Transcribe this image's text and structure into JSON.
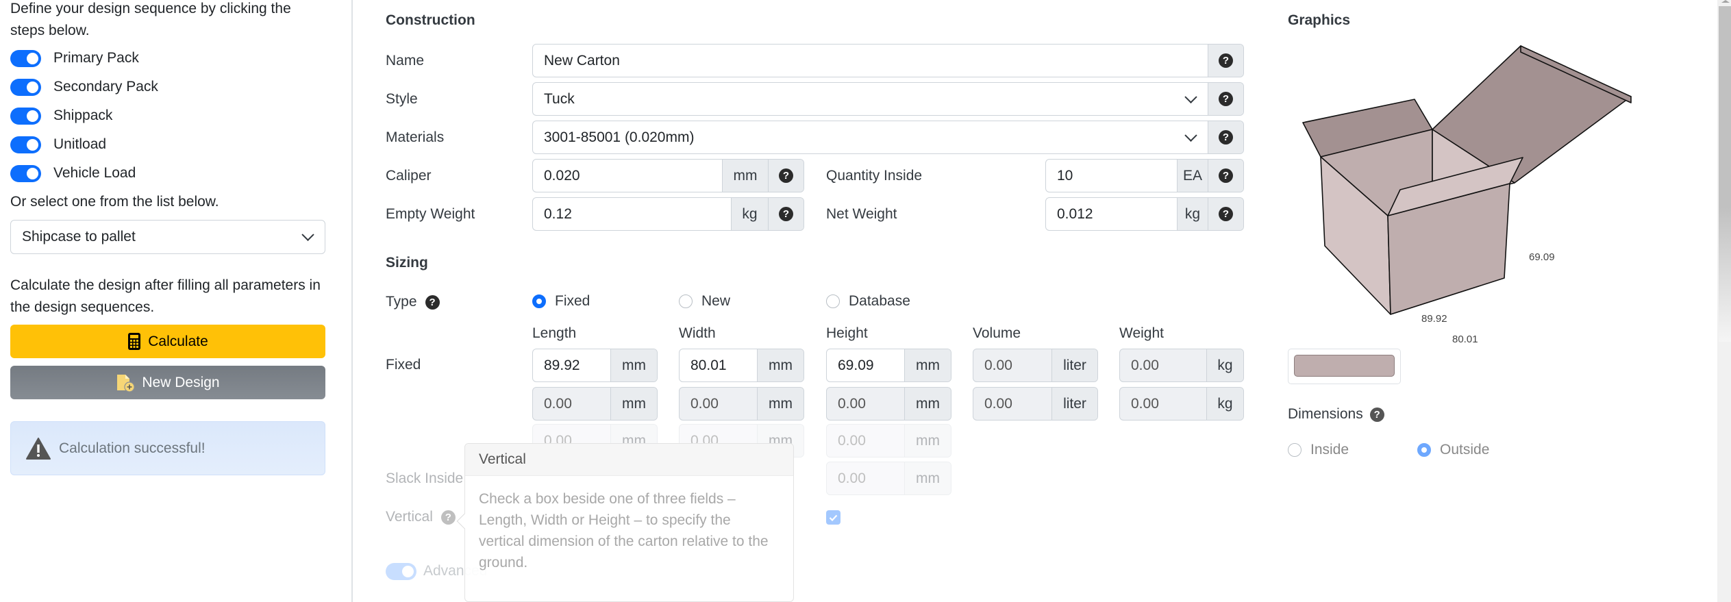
{
  "sidebar": {
    "intro": "Define your design sequence by clicking the steps below.",
    "sequence": [
      {
        "label": "Primary Pack",
        "enabled": true
      },
      {
        "label": "Secondary Pack",
        "enabled": true
      },
      {
        "label": "Shippack",
        "enabled": true
      },
      {
        "label": "Unitload",
        "enabled": true
      },
      {
        "label": "Vehicle Load",
        "enabled": true
      }
    ],
    "select_prompt": "Or select one from the list below.",
    "preset_select": {
      "value": "Shipcase to pallet"
    },
    "calculate_prompt": "Calculate the design after filling all parameters in the design sequences.",
    "calculate_button": "Calculate",
    "new_design_button": "New Design",
    "alert": {
      "text": "Calculation successful!",
      "icon": "warning-triangle-icon"
    }
  },
  "construction": {
    "title": "Construction",
    "name": {
      "label": "Name",
      "value": "New Carton"
    },
    "style": {
      "label": "Style",
      "value": "Tuck"
    },
    "materials": {
      "label": "Materials",
      "value": "3001-85001 (0.020mm)"
    },
    "caliper": {
      "label": "Caliper",
      "value": "0.020",
      "unit": "mm"
    },
    "empty_weight": {
      "label": "Empty Weight",
      "value": "0.12",
      "unit": "kg"
    },
    "quantity_inside": {
      "label": "Quantity Inside",
      "value": "10",
      "unit": "EA"
    },
    "net_weight": {
      "label": "Net Weight",
      "value": "0.012",
      "unit": "kg"
    },
    "help_glyph": "?"
  },
  "sizing": {
    "title": "Sizing",
    "type_label": "Type",
    "type_options": [
      {
        "label": "Fixed",
        "selected": true
      },
      {
        "label": "New",
        "selected": false
      },
      {
        "label": "Database",
        "selected": false
      }
    ],
    "columns": [
      "Length",
      "Width",
      "Height",
      "Volume",
      "Weight"
    ],
    "fixed_label": "Fixed",
    "rows": [
      {
        "length": {
          "value": "89.92",
          "unit": "mm"
        },
        "width": {
          "value": "80.01",
          "unit": "mm"
        },
        "height": {
          "value": "69.09",
          "unit": "mm"
        },
        "volume": {
          "value": "0.00",
          "unit": "liter"
        },
        "weight": {
          "value": "0.00",
          "unit": "kg"
        }
      },
      {
        "length": {
          "value": "0.00",
          "unit": "mm"
        },
        "width": {
          "value": "0.00",
          "unit": "mm"
        },
        "height": {
          "value": "0.00",
          "unit": "mm"
        },
        "volume": {
          "value": "0.00",
          "unit": "liter"
        },
        "weight": {
          "value": "0.00",
          "unit": "kg"
        }
      },
      {
        "length": {
          "value": "0.00",
          "unit": "mm"
        },
        "width": {
          "value": "0.00",
          "unit": "mm"
        },
        "height": {
          "value": "0.00",
          "unit": "mm"
        }
      }
    ],
    "slack_inside": {
      "label": "Slack Inside",
      "height": {
        "value": "0.00",
        "unit": "mm"
      }
    },
    "vertical": {
      "label": "Vertical",
      "height_checked": true
    },
    "advanced_toggle": {
      "label": "Advanced",
      "enabled": true
    }
  },
  "popover": {
    "title": "Vertical",
    "body": "Check a box beside one of three fields – Length, Width or Height – to specify the vertical dimension of the carton relative to the ground."
  },
  "graphics": {
    "title": "Graphics",
    "box_labels": {
      "length": "89.92",
      "width": "80.01",
      "height": "69.09"
    },
    "colors": {
      "face_light": "#d4c4c4",
      "face_mid": "#bfaeae",
      "flap": "#a39191"
    },
    "dimensions": {
      "label": "Dimensions",
      "options": [
        {
          "label": "Inside",
          "selected": false
        },
        {
          "label": "Outside",
          "selected": true
        }
      ]
    }
  },
  "colors": {
    "primary": "#0d6efd",
    "warning": "#ffc107",
    "secondary": "#6c757d"
  }
}
